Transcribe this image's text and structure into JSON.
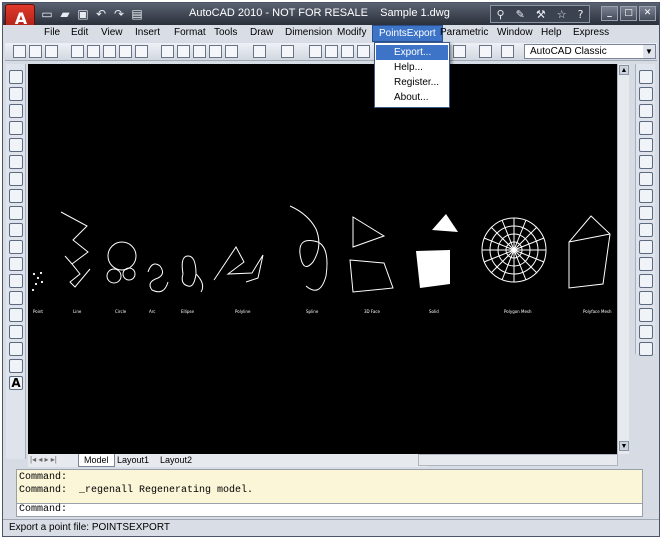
{
  "window": {
    "title": "AutoCAD 2010 - NOT FOR RESALE    Sample 1.dwg"
  },
  "menu": [
    "File",
    "Edit",
    "View",
    "Insert",
    "Format",
    "Tools",
    "Draw",
    "Dimension",
    "Modify",
    "PointsExport",
    "Parametric",
    "Window",
    "Help",
    "Express"
  ],
  "pointsexport_menu": [
    "Export...",
    "Help...",
    "Register...",
    "About..."
  ],
  "workspace": "AutoCAD Classic",
  "layout_tabs": [
    "Model",
    "Layout1",
    "Layout2"
  ],
  "command_lines": [
    "Command:",
    "Command:  _regenall Regenerating model."
  ],
  "command_prompt": "Command:",
  "status_text": "Export a point file: POINTSEXPORT",
  "canvas_labels": [
    "Point",
    "Line",
    "Circle",
    "Arc",
    "Ellipse",
    "Polyline",
    "Spline",
    "3D Face",
    "Solid",
    "Polygon Mesh",
    "Polyface Mesh"
  ],
  "colors": {
    "accent": "#3e74c8",
    "canvas": "#000000",
    "command_bg": "#fbf6d8"
  }
}
